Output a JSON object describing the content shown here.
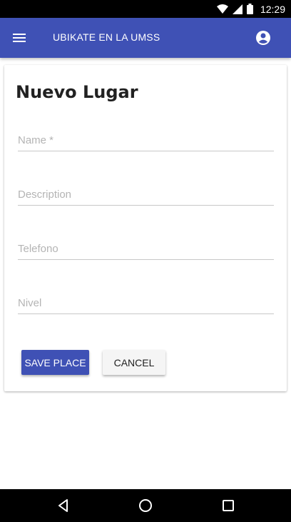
{
  "status_bar": {
    "time": "12:29",
    "icons": [
      "wifi-icon",
      "signal-icon",
      "battery-icon"
    ]
  },
  "app_bar": {
    "title": "UBIKATE EN LA UMSS",
    "menu_icon": "menu-icon",
    "account_icon": "account-circle-icon",
    "color": "#3f51b5"
  },
  "form": {
    "title": "Nuevo Lugar",
    "fields": [
      {
        "placeholder": "Name *",
        "value": ""
      },
      {
        "placeholder": "Description",
        "value": ""
      },
      {
        "placeholder": "Telefono",
        "value": ""
      },
      {
        "placeholder": "Nivel",
        "value": ""
      }
    ],
    "save_label": "SAVE PLACE",
    "cancel_label": "CANCEL"
  },
  "nav_bar": {
    "icons": [
      "back-icon",
      "home-icon",
      "recents-icon"
    ]
  }
}
